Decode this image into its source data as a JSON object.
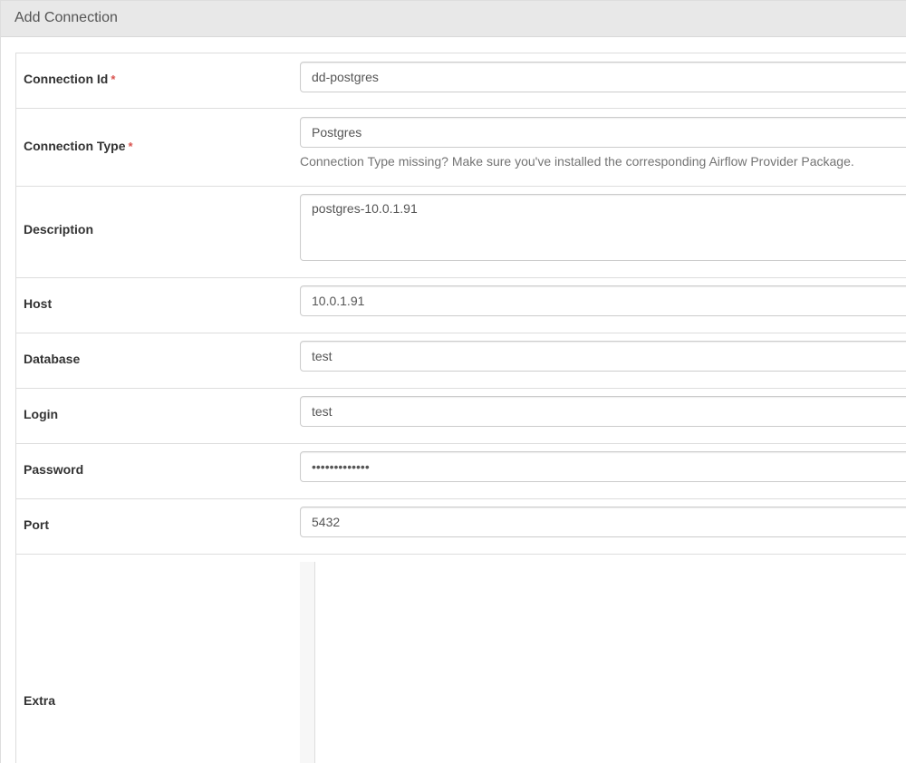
{
  "panel": {
    "title": "Add Connection"
  },
  "fields": {
    "conn_id": {
      "label": "Connection Id",
      "required_mark": "*",
      "value": "dd-postgres"
    },
    "conn_type": {
      "label": "Connection Type",
      "required_mark": "*",
      "value": "Postgres",
      "help": "Connection Type missing? Make sure you've installed the corresponding Airflow Provider Package."
    },
    "description": {
      "label": "Description",
      "value": "postgres-10.0.1.91"
    },
    "host": {
      "label": "Host",
      "value": "10.0.1.91"
    },
    "schema": {
      "label": "Database",
      "value": "test"
    },
    "login": {
      "label": "Login",
      "value": "test"
    },
    "password": {
      "label": "Password",
      "value": "•••••••••••••"
    },
    "port": {
      "label": "Port",
      "value": "5432"
    },
    "extra": {
      "label": "Extra",
      "value": ""
    }
  },
  "colors": {
    "required": "#d9534f",
    "heading_bg": "#e8e8e8",
    "border": "#dddddd"
  }
}
